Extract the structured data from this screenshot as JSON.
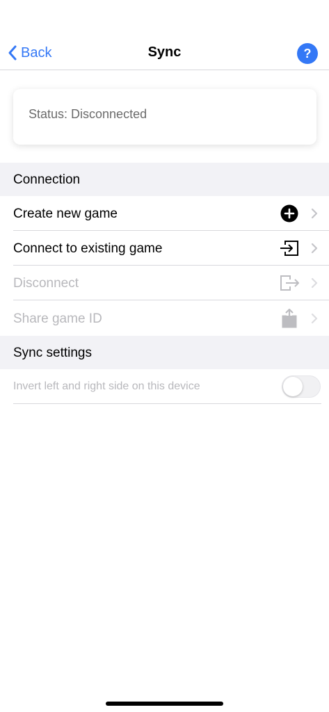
{
  "nav": {
    "back_label": "Back",
    "title": "Sync",
    "help_label": "?"
  },
  "status": {
    "text": "Status: Disconnected"
  },
  "sections": {
    "connection": "Connection",
    "sync_settings": "Sync settings"
  },
  "connection_items": [
    {
      "label": "Create new game",
      "icon": "plus-circle-icon",
      "enabled": true
    },
    {
      "label": "Connect to existing game",
      "icon": "sign-in-icon",
      "enabled": true
    },
    {
      "label": "Disconnect",
      "icon": "sign-out-icon",
      "enabled": false
    },
    {
      "label": "Share game ID",
      "icon": "share-icon",
      "enabled": false
    }
  ],
  "settings": {
    "invert_label": "Invert left and right side on this device",
    "invert_enabled": false
  },
  "colors": {
    "accent": "#3478f6",
    "disabled_text": "#b8b8bc",
    "section_bg": "#f2f2f6"
  }
}
